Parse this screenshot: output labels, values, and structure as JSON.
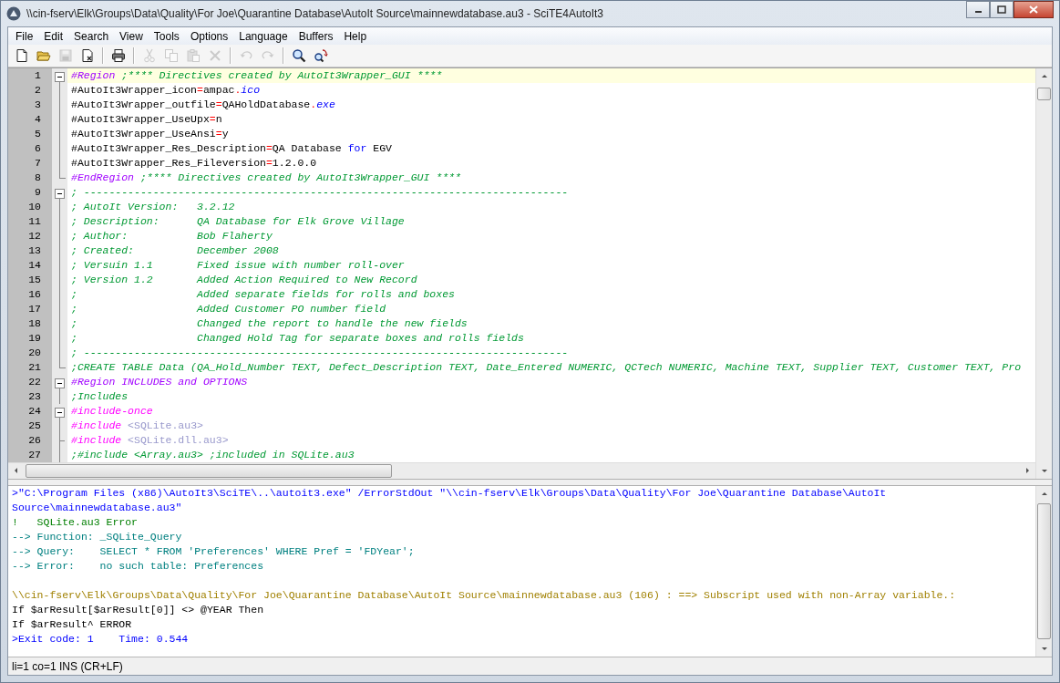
{
  "window": {
    "title": "\\\\cin-fserv\\Elk\\Groups\\Data\\Quality\\For Joe\\Quarantine Database\\AutoIt Source\\mainnewdatabase.au3 - SciTE4AutoIt3"
  },
  "menu": [
    "File",
    "Edit",
    "Search",
    "View",
    "Tools",
    "Options",
    "Language",
    "Buffers",
    "Help"
  ],
  "toolbar": [
    {
      "kind": "new",
      "disabled": false
    },
    {
      "kind": "open",
      "disabled": false
    },
    {
      "kind": "save",
      "disabled": true
    },
    {
      "kind": "close",
      "disabled": false
    },
    {
      "kind": "separator"
    },
    {
      "kind": "print",
      "disabled": false
    },
    {
      "kind": "separator"
    },
    {
      "kind": "cut",
      "disabled": true
    },
    {
      "kind": "copy",
      "disabled": true
    },
    {
      "kind": "paste",
      "disabled": true
    },
    {
      "kind": "delete",
      "disabled": true
    },
    {
      "kind": "separator"
    },
    {
      "kind": "undo",
      "disabled": true
    },
    {
      "kind": "redo",
      "disabled": true
    },
    {
      "kind": "separator"
    },
    {
      "kind": "find",
      "disabled": false
    },
    {
      "kind": "replace",
      "disabled": false
    }
  ],
  "editor": {
    "lines": [
      {
        "number": "1",
        "kind": "header",
        "current": true,
        "segments": [
          {
            "kind": "directive",
            "text": "#Region"
          },
          {
            "kind": "comment",
            "text": " ;**** Directives created by AutoIt3Wrapper_GUI ****"
          }
        ]
      },
      {
        "number": "2",
        "kind": "body",
        "current": false,
        "segments": [
          {
            "kind": "plain",
            "text": "#AutoIt3Wrapper_icon"
          },
          {
            "kind": "operator",
            "text": "="
          },
          {
            "kind": "plain",
            "text": "ampac"
          },
          {
            "kind": "operator",
            "text": "."
          },
          {
            "kind": "macro",
            "text": "ico"
          }
        ]
      },
      {
        "number": "3",
        "kind": "body",
        "current": false,
        "segments": [
          {
            "kind": "plain",
            "text": "#AutoIt3Wrapper_outfile"
          },
          {
            "kind": "operator",
            "text": "="
          },
          {
            "kind": "plain",
            "text": "QAHoldDatabase"
          },
          {
            "kind": "operator",
            "text": "."
          },
          {
            "kind": "macro",
            "text": "exe"
          }
        ]
      },
      {
        "number": "4",
        "kind": "body",
        "current": false,
        "segments": [
          {
            "kind": "plain",
            "text": "#AutoIt3Wrapper_UseUpx"
          },
          {
            "kind": "operator",
            "text": "="
          },
          {
            "kind": "plain",
            "text": "n"
          }
        ]
      },
      {
        "number": "5",
        "kind": "body",
        "current": false,
        "segments": [
          {
            "kind": "plain",
            "text": "#AutoIt3Wrapper_UseAnsi"
          },
          {
            "kind": "operator",
            "text": "="
          },
          {
            "kind": "plain",
            "text": "y"
          }
        ]
      },
      {
        "number": "6",
        "kind": "body",
        "current": false,
        "segments": [
          {
            "kind": "plain",
            "text": "#AutoIt3Wrapper_Res_Description"
          },
          {
            "kind": "operator",
            "text": "="
          },
          {
            "kind": "plain",
            "text": "QA Database "
          },
          {
            "kind": "keyword",
            "text": "for"
          },
          {
            "kind": "plain",
            "text": " EGV"
          }
        ]
      },
      {
        "number": "7",
        "kind": "body",
        "current": false,
        "segments": [
          {
            "kind": "plain",
            "text": "#AutoIt3Wrapper_Res_Fileversion"
          },
          {
            "kind": "operator",
            "text": "="
          },
          {
            "kind": "plain",
            "text": "1.2.0.0"
          }
        ]
      },
      {
        "number": "8",
        "kind": "end",
        "current": false,
        "segments": [
          {
            "kind": "directive",
            "text": "#EndRegion"
          },
          {
            "kind": "comment",
            "text": " ;**** Directives created by AutoIt3Wrapper_GUI ****"
          }
        ]
      },
      {
        "number": "9",
        "kind": "header",
        "current": false,
        "segments": [
          {
            "kind": "comment",
            "text": "; -----------------------------------------------------------------------------"
          }
        ]
      },
      {
        "number": "10",
        "kind": "body",
        "current": false,
        "segments": [
          {
            "kind": "comment",
            "text": "; AutoIt Version:   3.2.12"
          }
        ]
      },
      {
        "number": "11",
        "kind": "body",
        "current": false,
        "segments": [
          {
            "kind": "comment",
            "text": "; Description:      QA Database for Elk Grove Village"
          }
        ]
      },
      {
        "number": "12",
        "kind": "body",
        "current": false,
        "segments": [
          {
            "kind": "comment",
            "text": "; Author:           Bob Flaherty"
          }
        ]
      },
      {
        "number": "13",
        "kind": "body",
        "current": false,
        "segments": [
          {
            "kind": "comment",
            "text": "; Created:          December 2008"
          }
        ]
      },
      {
        "number": "14",
        "kind": "body",
        "current": false,
        "segments": [
          {
            "kind": "comment",
            "text": "; Versuin 1.1       Fixed issue with number roll-over"
          }
        ]
      },
      {
        "number": "15",
        "kind": "body",
        "current": false,
        "segments": [
          {
            "kind": "comment",
            "text": "; Version 1.2       Added Action Required to New Record"
          }
        ]
      },
      {
        "number": "16",
        "kind": "body",
        "current": false,
        "segments": [
          {
            "kind": "comment",
            "text": ";                   Added separate fields for rolls and boxes"
          }
        ]
      },
      {
        "number": "17",
        "kind": "body",
        "current": false,
        "segments": [
          {
            "kind": "comment",
            "text": ";                   Added Customer PO number field"
          }
        ]
      },
      {
        "number": "18",
        "kind": "body",
        "current": false,
        "segments": [
          {
            "kind": "comment",
            "text": ";                   Changed the report to handle the new fields"
          }
        ]
      },
      {
        "number": "19",
        "kind": "body",
        "current": false,
        "segments": [
          {
            "kind": "comment",
            "text": ";                   Changed Hold Tag for separate boxes and rolls fields"
          }
        ]
      },
      {
        "number": "20",
        "kind": "body",
        "current": false,
        "segments": [
          {
            "kind": "comment",
            "text": "; -----------------------------------------------------------------------------"
          }
        ]
      },
      {
        "number": "21",
        "kind": "end",
        "current": false,
        "segments": [
          {
            "kind": "comment",
            "text": ";CREATE TABLE Data (QA_Hold_Number TEXT, Defect_Description TEXT, Date_Entered NUMERIC, QCTech NUMERIC, Machine TEXT, Supplier TEXT, Customer TEXT, Pro"
          }
        ]
      },
      {
        "number": "22",
        "kind": "header",
        "current": false,
        "segments": [
          {
            "kind": "directive",
            "text": "#Region INCLUDES and OPTIONS"
          }
        ]
      },
      {
        "number": "23",
        "kind": "body",
        "current": false,
        "segments": [
          {
            "kind": "comment",
            "text": ";Includes"
          }
        ]
      },
      {
        "number": "24",
        "kind": "header",
        "current": false,
        "segments": [
          {
            "kind": "include",
            "text": "#include-once"
          }
        ]
      },
      {
        "number": "25",
        "kind": "body",
        "current": false,
        "segments": [
          {
            "kind": "include",
            "text": "#include"
          },
          {
            "kind": "string",
            "text": " <SQLite.au3>"
          }
        ]
      },
      {
        "number": "26",
        "kind": "branch",
        "current": false,
        "segments": [
          {
            "kind": "include",
            "text": "#include"
          },
          {
            "kind": "string",
            "text": " <SQLite.dll.au3>"
          }
        ]
      },
      {
        "number": "27",
        "kind": "body",
        "current": false,
        "segments": [
          {
            "kind": "comment",
            "text": ";#include <Array.au3> ;included in SQLite.au3"
          }
        ]
      }
    ]
  },
  "output": {
    "lines": [
      {
        "kind": "command",
        "text": ">\"C:\\Program Files (x86)\\AutoIt3\\SciTE\\..\\autoit3.exe\" /ErrorStdOut \"\\\\cin-fserv\\Elk\\Groups\\Data\\Quality\\For Joe\\Quarantine Database\\AutoIt"
      },
      {
        "kind": "command",
        "text": "Source\\mainnewdatabase.au3\""
      },
      {
        "kind": "error",
        "text": "!   SQLite.au3 Error"
      },
      {
        "kind": "info",
        "text": "--> Function: _SQLite_Query"
      },
      {
        "kind": "info",
        "text": "--> Query:    SELECT * FROM 'Preferences' WHERE Pref = 'FDYear';"
      },
      {
        "kind": "info",
        "text": "--> Error:    no such table: Preferences"
      },
      {
        "kind": "blank"
      },
      {
        "kind": "warning",
        "text": "\\\\cin-fserv\\Elk\\Groups\\Data\\Quality\\For Joe\\Quarantine Database\\AutoIt Source\\mainnewdatabase.au3 (106) : ==> Subscript used with non-Array variable.:"
      },
      {
        "kind": "plain",
        "text": "If $arResult[$arResult[0]] <> @YEAR Then"
      },
      {
        "kind": "plain",
        "text": "If $arResult^ ERROR"
      },
      {
        "kind": "exit",
        "text": ">Exit code: 1    Time: 0.544"
      }
    ]
  },
  "status_bar": "li=1 co=1 INS (CR+LF)"
}
